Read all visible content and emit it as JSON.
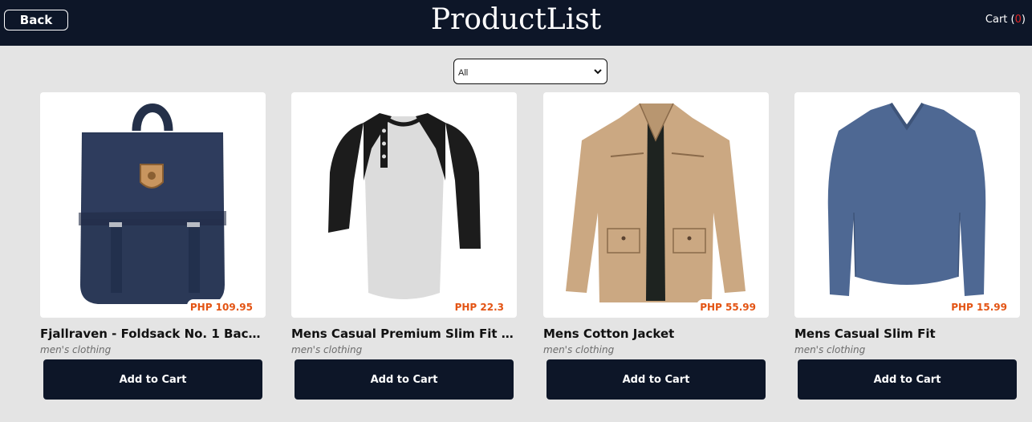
{
  "header": {
    "back_label": "Back",
    "title": "ProductList",
    "cart_label": "Cart",
    "cart_count": "0"
  },
  "filter": {
    "selected": "All"
  },
  "products": [
    {
      "name": "Fjallraven - Foldsack No. 1 Backpac...",
      "category": "men's clothing",
      "price": "PHP 109.95",
      "button": "Add to Cart",
      "image": "backpack"
    },
    {
      "name": "Mens Casual Premium Slim Fit T-...",
      "category": "men's clothing",
      "price": "PHP 22.3",
      "button": "Add to Cart",
      "image": "raglan-tshirt"
    },
    {
      "name": "Mens Cotton Jacket",
      "category": "men's clothing",
      "price": "PHP 55.99",
      "button": "Add to Cart",
      "image": "cotton-jacket"
    },
    {
      "name": "Mens Casual Slim Fit",
      "category": "men's clothing",
      "price": "PHP 15.99",
      "button": "Add to Cart",
      "image": "longsleeve-shirt"
    }
  ],
  "colors": {
    "navbar": "#0d1628",
    "price": "#e35414",
    "cart_count": "#e02424",
    "background": "#e4e4e4"
  }
}
